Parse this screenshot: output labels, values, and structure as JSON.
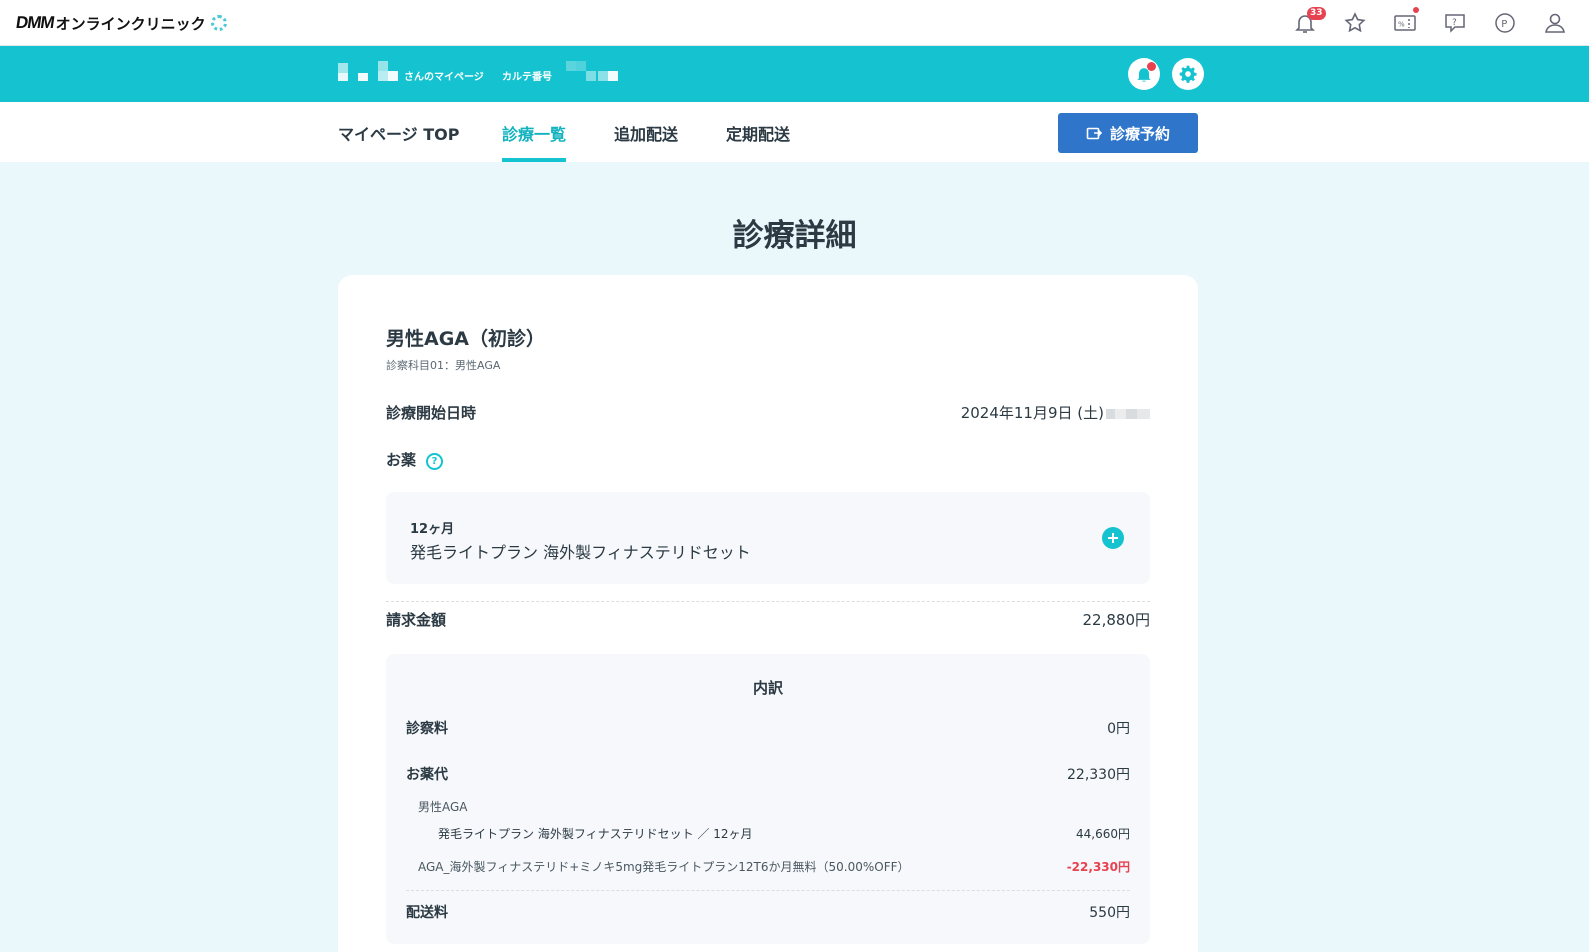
{
  "header": {
    "logo_brand": "DMM",
    "logo_text": "オンラインクリニック",
    "icons": [
      {
        "name": "bell-icon",
        "badge": "33"
      },
      {
        "name": "star-icon"
      },
      {
        "name": "coupon-icon",
        "dot": true
      },
      {
        "name": "help-chat-icon"
      },
      {
        "name": "point-icon"
      },
      {
        "name": "user-icon"
      }
    ]
  },
  "userbar": {
    "mypage_suffix": "さんのマイページ",
    "chart_label": "カルテ番号"
  },
  "nav": {
    "tabs": [
      {
        "label": "マイページ TOP",
        "active": false
      },
      {
        "label": "診療一覧",
        "active": true
      },
      {
        "label": "追加配送",
        "active": false
      },
      {
        "label": "定期配送",
        "active": false
      }
    ],
    "reserve_label": "診療予約"
  },
  "page": {
    "title": "診療詳細"
  },
  "detail": {
    "title": "男性AGA（初診）",
    "subtitle": "診察科目01：男性AGA",
    "start_label": "診療開始日時",
    "start_value": "2024年11月9日 (土)",
    "medicine_label": "お薬",
    "medicine": {
      "period": "12ヶ月",
      "name": "発毛ライトプラン 海外製フィナステリドセット"
    },
    "billing_label": "請求金額",
    "billing_value": "22,880円",
    "breakdown": {
      "title": "内訳",
      "consult_label": "診察料",
      "consult_value": "0円",
      "medicine_fee_label": "お薬代",
      "medicine_fee_value": "22,330円",
      "category": "男性AGA",
      "item_label": "発毛ライトプラン 海外製フィナステリドセット ／ 12ヶ月",
      "item_value": "44,660円",
      "discount_label": "AGA_海外製フィナステリド+ミノキ5mg発毛ライトプラン12T6か月無料（50.00%OFF）",
      "discount_value": "-22,330円",
      "shipping_label": "配送料",
      "shipping_value": "550円"
    }
  },
  "colors": {
    "accent": "#14c3cf",
    "button_blue": "#2f75c9",
    "discount_red": "#e8414f",
    "page_bg": "#eaf7fb"
  }
}
